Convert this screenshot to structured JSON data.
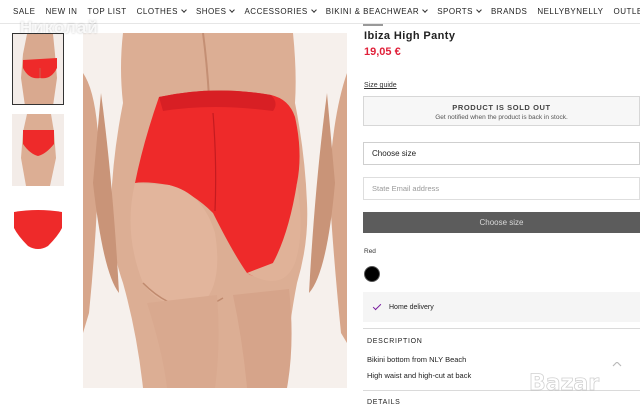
{
  "nav": {
    "items": [
      {
        "label": "SALE",
        "dropdown": false
      },
      {
        "label": "NEW IN",
        "dropdown": false
      },
      {
        "label": "TOP LIST",
        "dropdown": false
      },
      {
        "label": "CLOTHES",
        "dropdown": true
      },
      {
        "label": "SHOES",
        "dropdown": true
      },
      {
        "label": "ACCESSORIES",
        "dropdown": true
      },
      {
        "label": "BIKINI & BEACHWEAR",
        "dropdown": true
      },
      {
        "label": "SPORTS",
        "dropdown": true
      },
      {
        "label": "BRANDS",
        "dropdown": false
      },
      {
        "label": "NELLYBYNELLY",
        "dropdown": false
      },
      {
        "label": "OUTLET",
        "dropdown": false
      }
    ]
  },
  "watermark_top": "Николай",
  "product": {
    "title": "Ibiza High Panty",
    "price": "19,05 €",
    "size_guide": "Size guide",
    "sold_out_title": "PRODUCT IS SOLD OUT",
    "sold_out_sub": "Get notified when the product is back in stock.",
    "choose_size_select": "Choose size",
    "email_placeholder": "State Email address",
    "choose_size_button": "Choose size",
    "color_name": "Red",
    "swatch_color": "#000000",
    "delivery_label": "Home delivery",
    "description_heading": "DESCRIPTION",
    "description_lines": [
      "Bikini bottom from NLY Beach",
      "High waist and high-cut at back"
    ],
    "details_heading": "DETAILS"
  },
  "colors": {
    "price_red": "#e0213a",
    "bikini_red": "#ee2a2a",
    "skin": "#dcae94",
    "button_grey": "#5c5c5c",
    "check_purple": "#7a1fa0"
  },
  "watermark_bottom": "Bazar"
}
